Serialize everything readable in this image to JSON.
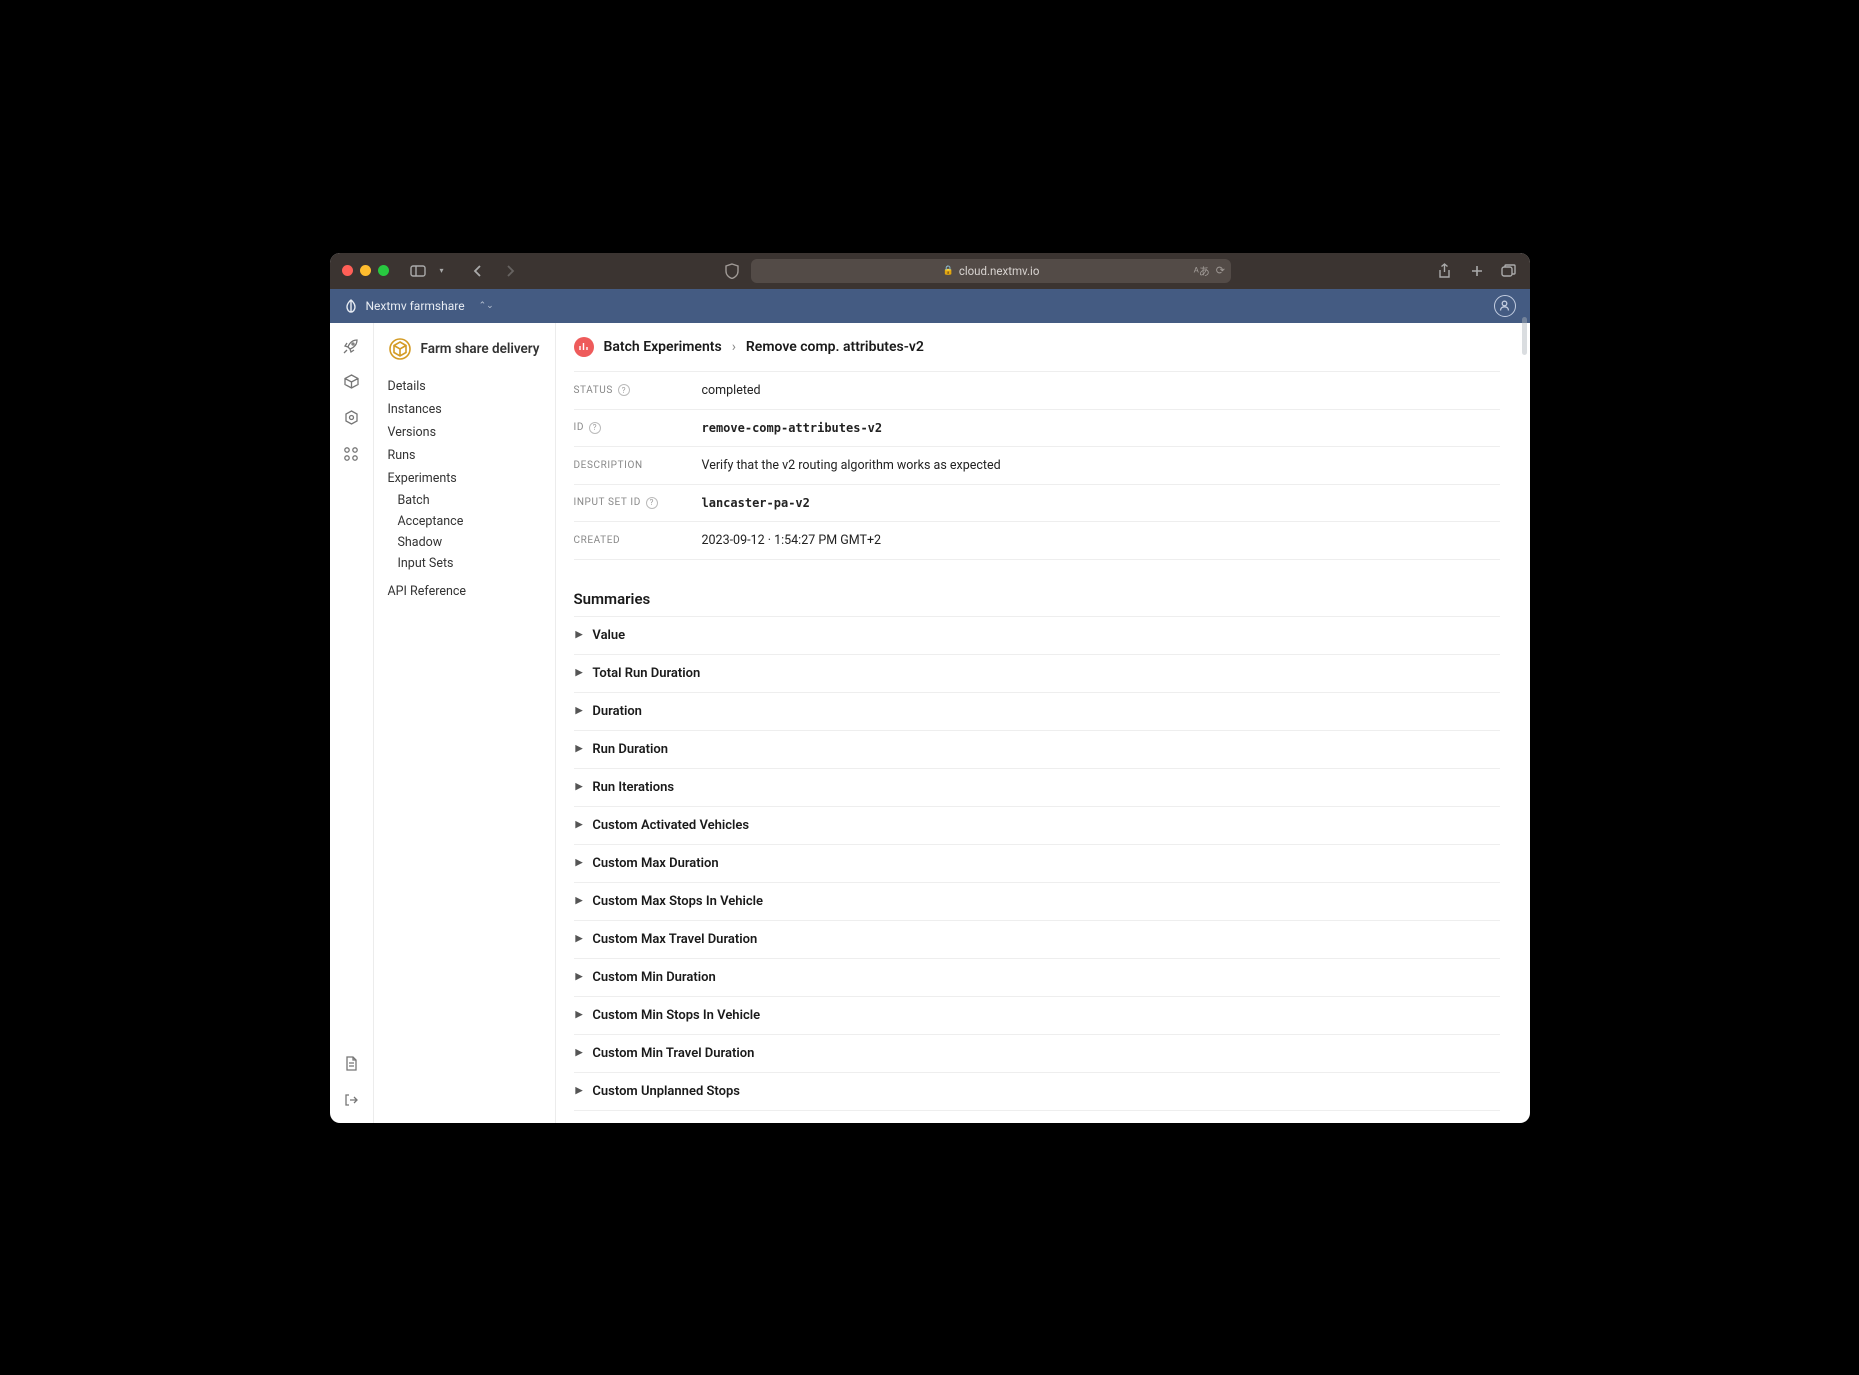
{
  "browser": {
    "url": "cloud.nextmv.io"
  },
  "appnav": {
    "org_name": "Nextmv farmshare"
  },
  "sidebar": {
    "title": "Farm share delivery",
    "items": {
      "details": "Details",
      "instances": "Instances",
      "versions": "Versions",
      "runs": "Runs",
      "experiments": "Experiments",
      "api_reference": "API Reference"
    },
    "experiments_sub": {
      "batch": "Batch",
      "acceptance": "Acceptance",
      "shadow": "Shadow",
      "input_sets": "Input Sets"
    }
  },
  "breadcrumbs": {
    "root": "Batch Experiments",
    "leaf": "Remove comp. attributes-v2"
  },
  "meta": {
    "status_label": "Status",
    "status_value": "completed",
    "id_label": "ID",
    "id_value": "remove-comp-attributes-v2",
    "description_label": "Description",
    "description_value": "Verify that the v2 routing algorithm works as expected",
    "input_set_id_label": "Input Set ID",
    "input_set_id_value": "lancaster-pa-v2",
    "created_label": "Created",
    "created_value": "2023-09-12 · 1:54:27 PM GMT+2"
  },
  "summaries": {
    "heading": "Summaries",
    "rows": [
      "Value",
      "Total Run Duration",
      "Duration",
      "Run Duration",
      "Run Iterations",
      "Custom Activated Vehicles",
      "Custom Max Duration",
      "Custom Max Stops In Vehicle",
      "Custom Max Travel Duration",
      "Custom Min Duration",
      "Custom Min Stops In Vehicle",
      "Custom Min Travel Duration",
      "Custom Unplanned Stops"
    ]
  }
}
